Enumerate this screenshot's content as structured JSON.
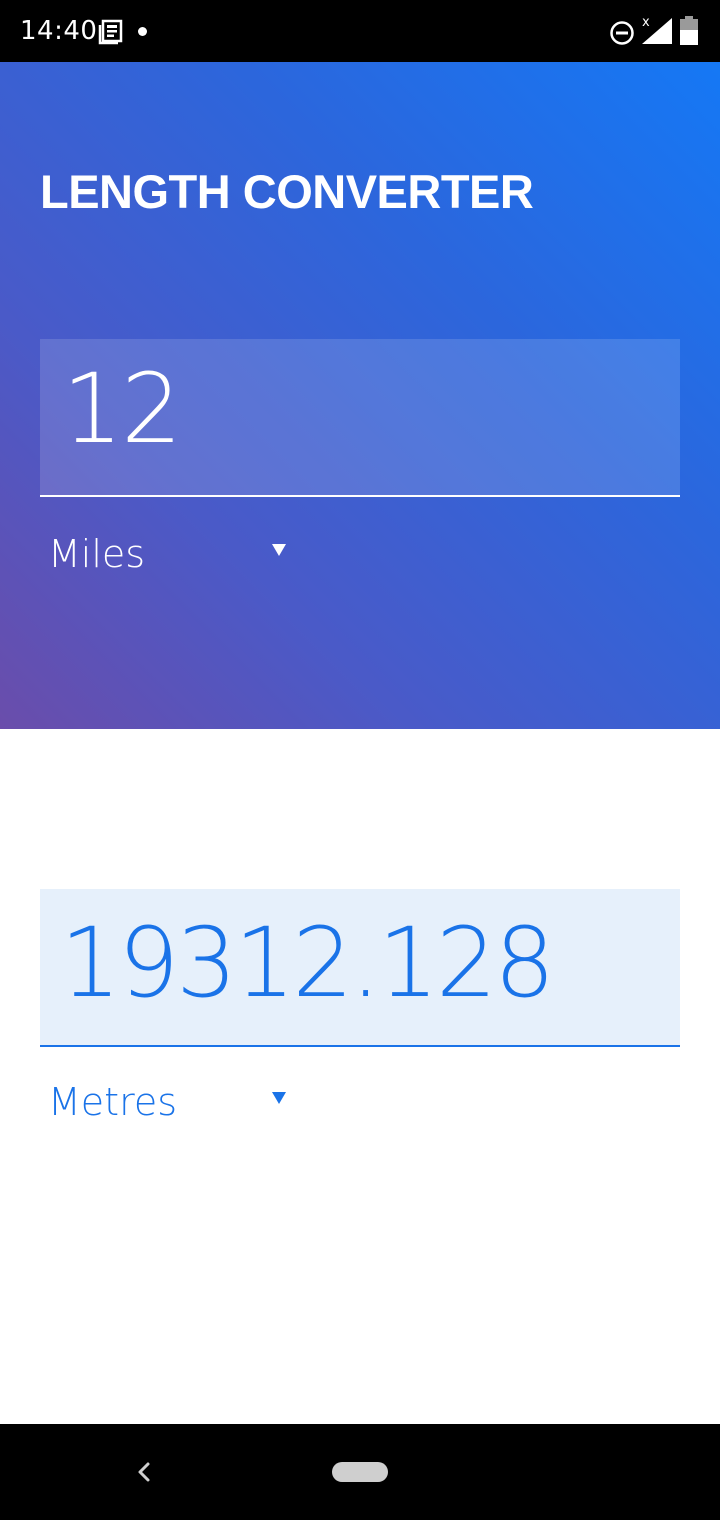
{
  "status_bar": {
    "time": "14:40",
    "icons": [
      "news-icon",
      "notification-dot",
      "do-not-disturb-icon",
      "signal-no-data-icon",
      "battery-icon"
    ]
  },
  "header": {
    "title": "LENGTH CONVERTER"
  },
  "input": {
    "value": "12",
    "unit": "Miles"
  },
  "output": {
    "value": "19312.128",
    "unit": "Metres"
  },
  "colors": {
    "accent": "#1a73e8",
    "gradient_start": "#1578f5",
    "gradient_end": "#6a4dab"
  },
  "nav_bar": {
    "icons": [
      "back-icon",
      "home-pill"
    ]
  }
}
